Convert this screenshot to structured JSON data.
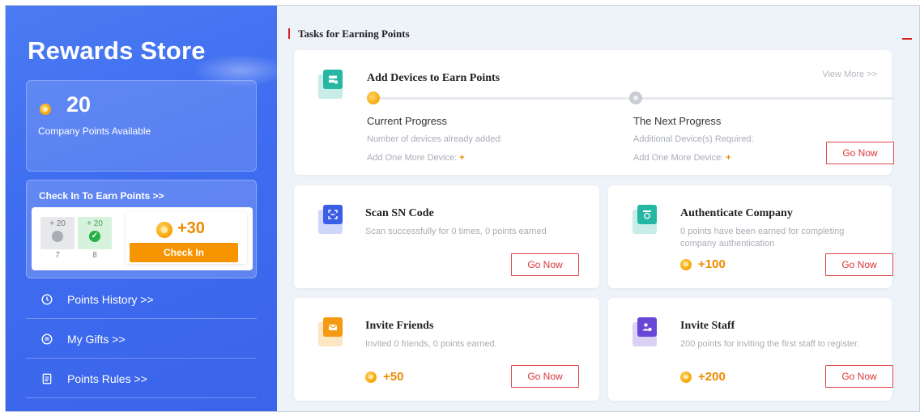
{
  "sidebar": {
    "title": "Rewards Store",
    "points_value": "20",
    "points_label": "Company Points Available",
    "checkin": {
      "title": "Check In To Earn Points >>",
      "days": [
        {
          "reward": "+ 20",
          "day": "7",
          "checked": false
        },
        {
          "reward": "+ 20",
          "day": "8",
          "checked": true
        }
      ],
      "today_reward": "+30",
      "button_label": "Check In"
    },
    "links": [
      {
        "label": "Points History >>",
        "icon": "clock-icon"
      },
      {
        "label": "My Gifts >>",
        "icon": "gift-icon"
      },
      {
        "label": "Points Rules >>",
        "icon": "document-icon"
      }
    ]
  },
  "main": {
    "section_title": "Tasks for Earning Points",
    "devices": {
      "title": "Add Devices to Earn Points",
      "view_more": "View More >>",
      "current": {
        "heading": "Current Progress",
        "line1": "Number of devices already added:",
        "line2": "Add One More Device:",
        "line2_suffix": "+"
      },
      "next": {
        "heading": "The Next Progress",
        "line1": "Additional Device(s) Required:",
        "line2": "Add One More Device:",
        "line2_suffix": "+"
      },
      "button": "Go Now"
    },
    "tasks": [
      {
        "title": "Scan SN Code",
        "desc": "Scan successfully for 0 times, 0 points earned",
        "reward": "",
        "button": "Go Now",
        "icon": "scan-icon",
        "color": "#3b5ee8"
      },
      {
        "title": "Authenticate Company",
        "desc": "0 points have been earned for completing company authentication",
        "reward": "+100",
        "button": "Go Now",
        "icon": "badge-icon",
        "color": "#24b7a4"
      },
      {
        "title": "Invite Friends",
        "desc": "Invited 0 friends, 0 points earned.",
        "reward": "+50",
        "button": "Go Now",
        "icon": "envelope-icon",
        "color": "#f59a12"
      },
      {
        "title": "Invite Staff",
        "desc": "200 points for inviting the first staff to register.",
        "reward": "+200",
        "button": "Go Now",
        "icon": "add-user-icon",
        "color": "#6a46d8"
      }
    ]
  },
  "colors": {
    "sidebar": "#3f6df0",
    "accent_red": "#d9363a",
    "coin_orange": "#ee8a00",
    "checkin_button": "#f79500"
  }
}
